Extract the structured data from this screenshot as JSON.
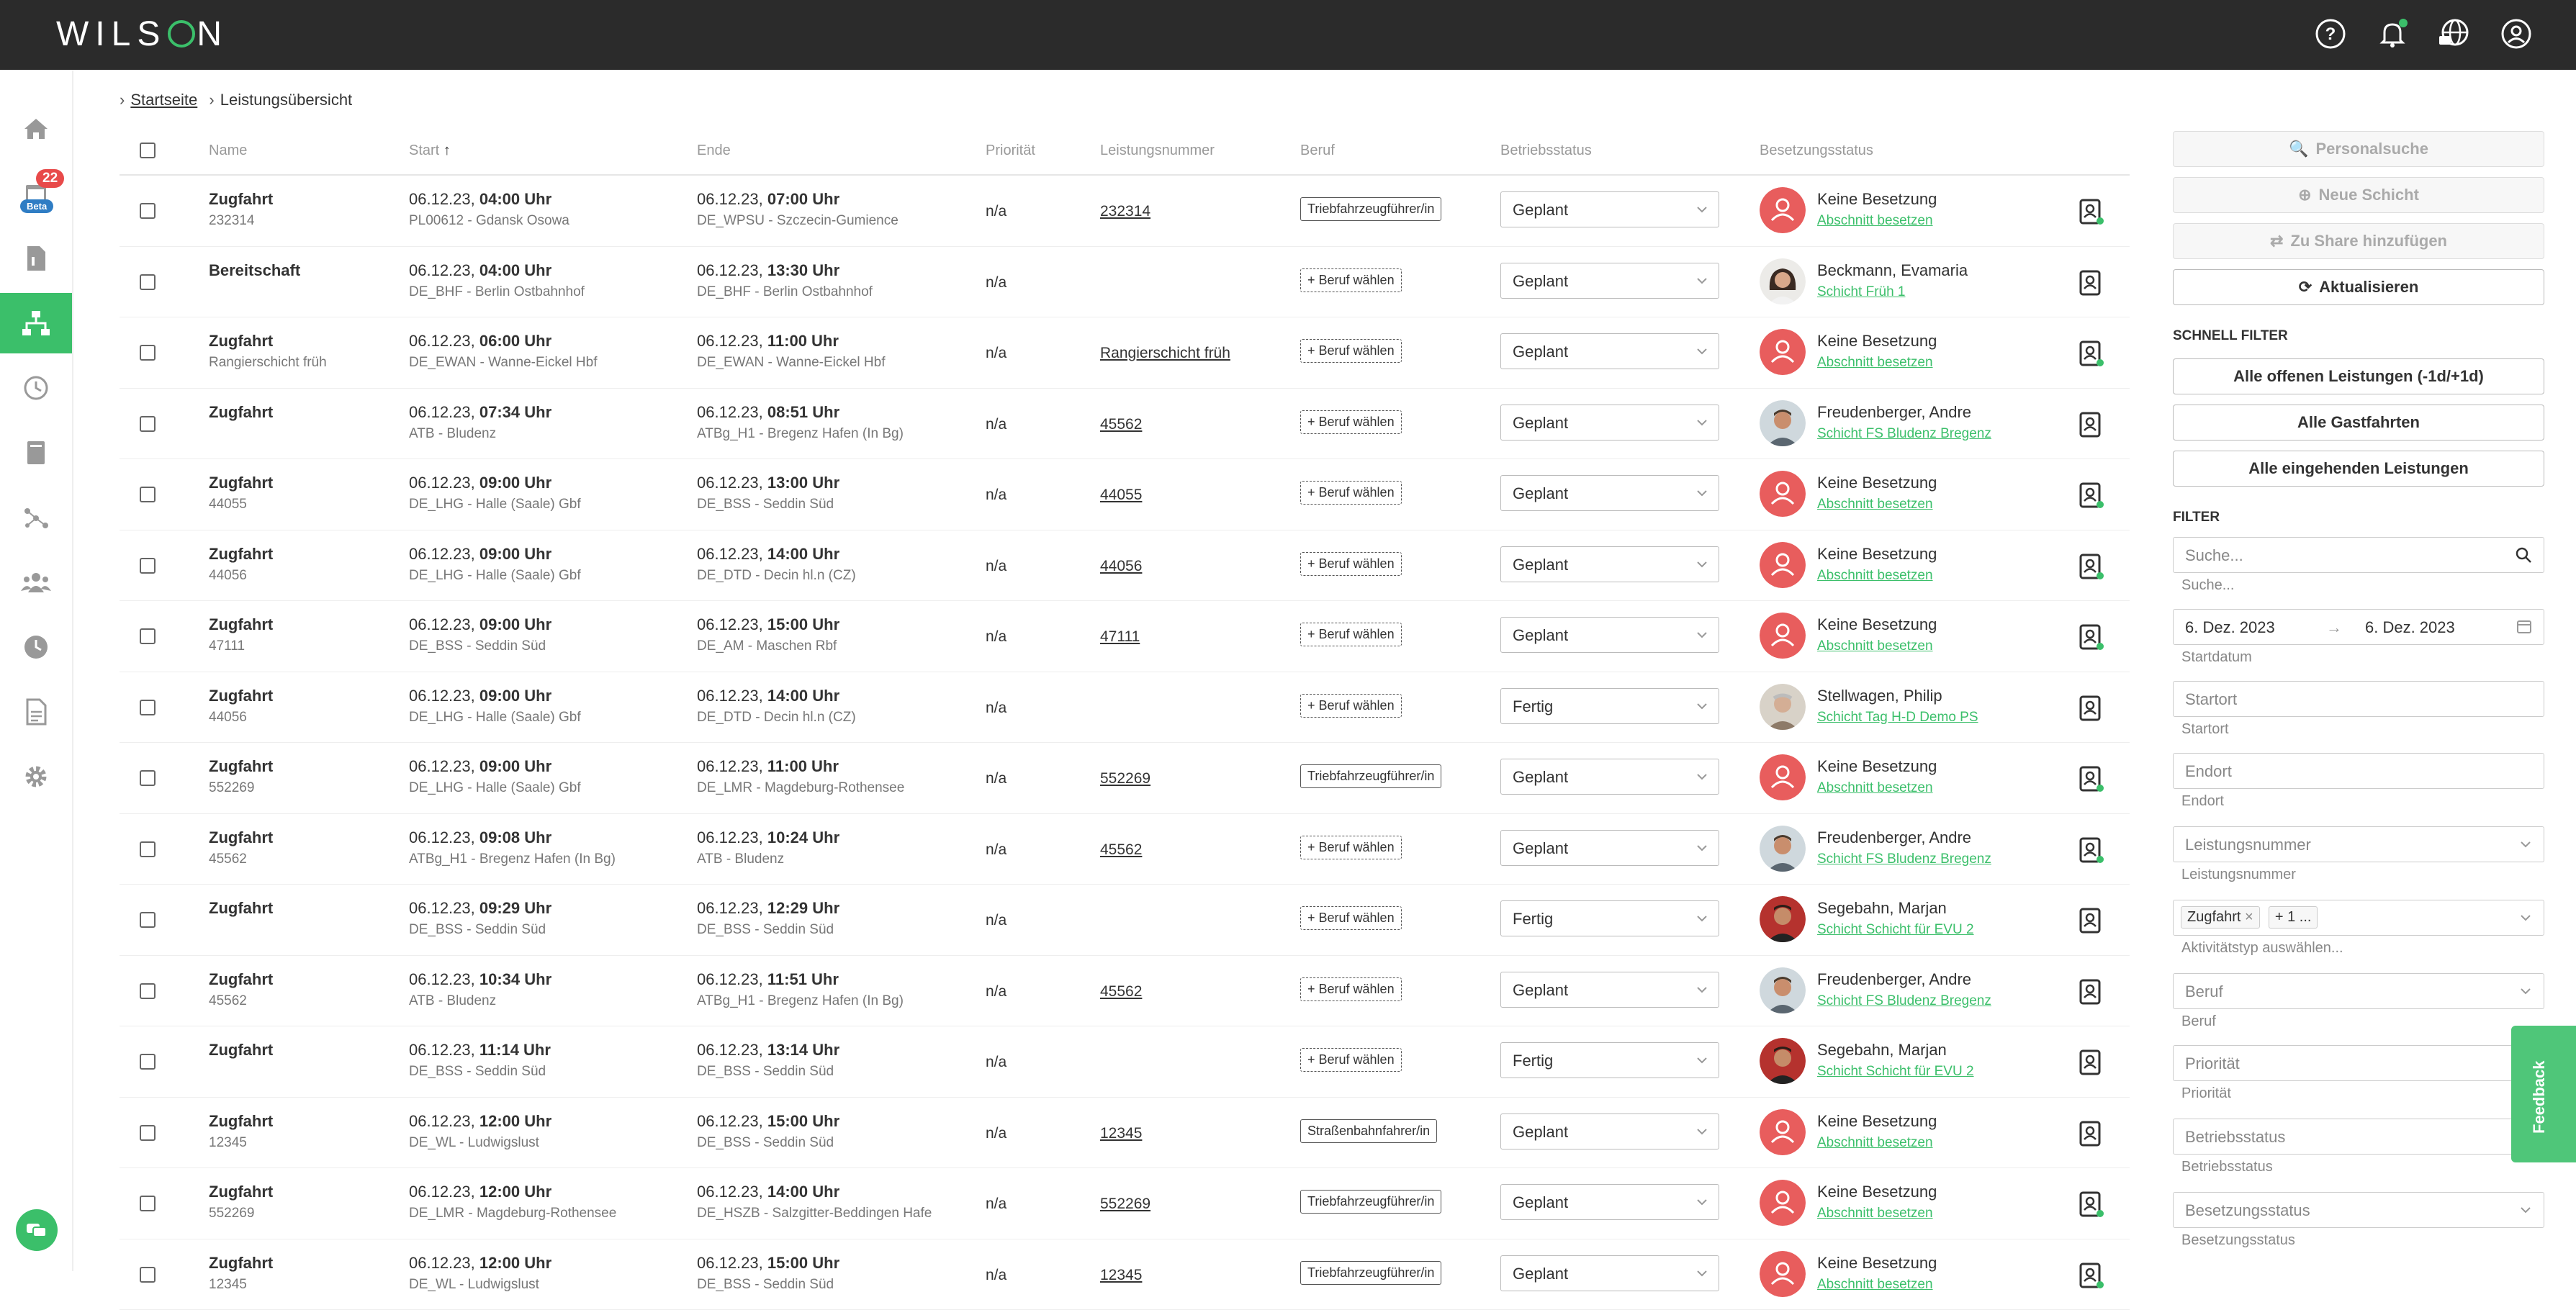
{
  "app": {
    "logo_text_left": "WILS",
    "logo_text_right": "N"
  },
  "sidebar": {
    "badge_count": "22",
    "beta_label": "Beta",
    "accent": "#3bbf6a"
  },
  "breadcrumb": {
    "home": "Startseite",
    "current": "Leistungsübersicht"
  },
  "table": {
    "headers": {
      "name": "Name",
      "start": "Start",
      "end": "Ende",
      "priority": "Priorität",
      "leistungsnummer": "Leistungsnummer",
      "beruf": "Beruf",
      "betriebsstatus": "Betriebsstatus",
      "besetzungsstatus": "Besetzungsstatus"
    },
    "rows": [
      {
        "name": "Zugfahrt",
        "sub": "232314",
        "start_date": "06.12.23,",
        "start_time": "04:00 Uhr",
        "start_loc": "PL00612 - Gdansk Osowa",
        "end_date": "06.12.23,",
        "end_time": "07:00 Uhr",
        "end_loc": "DE_WPSU - Szczecin-Gumience",
        "prio": "n/a",
        "lnum": "232314",
        "beruf": "Triebfahrzeugführer/in",
        "beruf_dashed": false,
        "status": "Geplant",
        "person": "Keine Besetzung",
        "link": "Abschnitt besetzen",
        "avatar": "none",
        "act_dot": true
      },
      {
        "name": "Bereitschaft",
        "sub": "",
        "start_date": "06.12.23,",
        "start_time": "04:00 Uhr",
        "start_loc": "DE_BHF - Berlin Ostbahnhof",
        "end_date": "06.12.23,",
        "end_time": "13:30 Uhr",
        "end_loc": "DE_BHF - Berlin Ostbahnhof",
        "prio": "n/a",
        "lnum": "",
        "beruf": "+ Beruf wählen",
        "beruf_dashed": true,
        "status": "Geplant",
        "person": "Beckmann, Evamaria",
        "link": "Schicht Früh 1",
        "avatar": "woman",
        "act_dot": false
      },
      {
        "name": "Zugfahrt",
        "sub": "Rangierschicht früh",
        "start_date": "06.12.23,",
        "start_time": "06:00 Uhr",
        "start_loc": "DE_EWAN - Wanne-Eickel Hbf",
        "end_date": "06.12.23,",
        "end_time": "11:00 Uhr",
        "end_loc": "DE_EWAN - Wanne-Eickel Hbf",
        "prio": "n/a",
        "lnum": "Rangierschicht früh",
        "beruf": "+ Beruf wählen",
        "beruf_dashed": true,
        "status": "Geplant",
        "person": "Keine Besetzung",
        "link": "Abschnitt besetzen",
        "avatar": "none",
        "act_dot": true
      },
      {
        "name": "Zugfahrt",
        "sub": "",
        "start_date": "06.12.23,",
        "start_time": "07:34 Uhr",
        "start_loc": "ATB - Bludenz",
        "end_date": "06.12.23,",
        "end_time": "08:51 Uhr",
        "end_loc": "ATBg_H1 - Bregenz Hafen (In Bg)",
        "prio": "n/a",
        "lnum": "45562",
        "beruf": "+ Beruf wählen",
        "beruf_dashed": true,
        "status": "Geplant",
        "person": "Freudenberger, Andre",
        "link": "Schicht FS Bludenz Bregenz",
        "avatar": "man1",
        "act_dot": false
      },
      {
        "name": "Zugfahrt",
        "sub": "44055",
        "start_date": "06.12.23,",
        "start_time": "09:00 Uhr",
        "start_loc": "DE_LHG - Halle (Saale) Gbf",
        "end_date": "06.12.23,",
        "end_time": "13:00 Uhr",
        "end_loc": "DE_BSS - Seddin Süd",
        "prio": "n/a",
        "lnum": "44055",
        "beruf": "+ Beruf wählen",
        "beruf_dashed": true,
        "status": "Geplant",
        "person": "Keine Besetzung",
        "link": "Abschnitt besetzen",
        "avatar": "none",
        "act_dot": true
      },
      {
        "name": "Zugfahrt",
        "sub": "44056",
        "start_date": "06.12.23,",
        "start_time": "09:00 Uhr",
        "start_loc": "DE_LHG - Halle (Saale) Gbf",
        "end_date": "06.12.23,",
        "end_time": "14:00 Uhr",
        "end_loc": "DE_DTD - Decin hl.n (CZ)",
        "prio": "n/a",
        "lnum": "44056",
        "beruf": "+ Beruf wählen",
        "beruf_dashed": true,
        "status": "Geplant",
        "person": "Keine Besetzung",
        "link": "Abschnitt besetzen",
        "avatar": "none",
        "act_dot": true
      },
      {
        "name": "Zugfahrt",
        "sub": "47111",
        "start_date": "06.12.23,",
        "start_time": "09:00 Uhr",
        "start_loc": "DE_BSS - Seddin Süd",
        "end_date": "06.12.23,",
        "end_time": "15:00 Uhr",
        "end_loc": "DE_AM - Maschen Rbf",
        "prio": "n/a",
        "lnum": "47111",
        "beruf": "+ Beruf wählen",
        "beruf_dashed": true,
        "status": "Geplant",
        "person": "Keine Besetzung",
        "link": "Abschnitt besetzen",
        "avatar": "none",
        "act_dot": true
      },
      {
        "name": "Zugfahrt",
        "sub": "44056",
        "start_date": "06.12.23,",
        "start_time": "09:00 Uhr",
        "start_loc": "DE_LHG - Halle (Saale) Gbf",
        "end_date": "06.12.23,",
        "end_time": "14:00 Uhr",
        "end_loc": "DE_DTD - Decin hl.n (CZ)",
        "prio": "n/a",
        "lnum": "",
        "beruf": "+ Beruf wählen",
        "beruf_dashed": true,
        "status": "Fertig",
        "person": "Stellwagen, Philip",
        "link": "Schicht Tag H-D Demo PS",
        "avatar": "man2",
        "act_dot": false
      },
      {
        "name": "Zugfahrt",
        "sub": "552269",
        "start_date": "06.12.23,",
        "start_time": "09:00 Uhr",
        "start_loc": "DE_LHG - Halle (Saale) Gbf",
        "end_date": "06.12.23,",
        "end_time": "11:00 Uhr",
        "end_loc": "DE_LMR - Magdeburg-Rothensee",
        "prio": "n/a",
        "lnum": "552269",
        "beruf": "Triebfahrzeugführer/in",
        "beruf_dashed": false,
        "status": "Geplant",
        "person": "Keine Besetzung",
        "link": "Abschnitt besetzen",
        "avatar": "none",
        "act_dot": true
      },
      {
        "name": "Zugfahrt",
        "sub": "45562",
        "start_date": "06.12.23,",
        "start_time": "09:08 Uhr",
        "start_loc": "ATBg_H1 - Bregenz Hafen (In Bg)",
        "end_date": "06.12.23,",
        "end_time": "10:24 Uhr",
        "end_loc": "ATB - Bludenz",
        "prio": "n/a",
        "lnum": "45562",
        "beruf": "+ Beruf wählen",
        "beruf_dashed": true,
        "status": "Geplant",
        "person": "Freudenberger, Andre",
        "link": "Schicht FS Bludenz Bregenz",
        "avatar": "man1",
        "act_dot": true
      },
      {
        "name": "Zugfahrt",
        "sub": "",
        "start_date": "06.12.23,",
        "start_time": "09:29 Uhr",
        "start_loc": "DE_BSS - Seddin Süd",
        "end_date": "06.12.23,",
        "end_time": "12:29 Uhr",
        "end_loc": "DE_BSS - Seddin Süd",
        "prio": "n/a",
        "lnum": "",
        "beruf": "+ Beruf wählen",
        "beruf_dashed": true,
        "status": "Fertig",
        "person": "Segebahn, Marjan",
        "link": "Schicht Schicht für EVU 2",
        "avatar": "man3",
        "act_dot": false
      },
      {
        "name": "Zugfahrt",
        "sub": "45562",
        "start_date": "06.12.23,",
        "start_time": "10:34 Uhr",
        "start_loc": "ATB - Bludenz",
        "end_date": "06.12.23,",
        "end_time": "11:51 Uhr",
        "end_loc": "ATBg_H1 - Bregenz Hafen (In Bg)",
        "prio": "n/a",
        "lnum": "45562",
        "beruf": "+ Beruf wählen",
        "beruf_dashed": true,
        "status": "Geplant",
        "person": "Freudenberger, Andre",
        "link": "Schicht FS Bludenz Bregenz",
        "avatar": "man1",
        "act_dot": false
      },
      {
        "name": "Zugfahrt",
        "sub": "",
        "start_date": "06.12.23,",
        "start_time": "11:14 Uhr",
        "start_loc": "DE_BSS - Seddin Süd",
        "end_date": "06.12.23,",
        "end_time": "13:14 Uhr",
        "end_loc": "DE_BSS - Seddin Süd",
        "prio": "n/a",
        "lnum": "",
        "beruf": "+ Beruf wählen",
        "beruf_dashed": true,
        "status": "Fertig",
        "person": "Segebahn, Marjan",
        "link": "Schicht Schicht für EVU 2",
        "avatar": "man3",
        "act_dot": false
      },
      {
        "name": "Zugfahrt",
        "sub": "12345",
        "start_date": "06.12.23,",
        "start_time": "12:00 Uhr",
        "start_loc": "DE_WL - Ludwigslust",
        "end_date": "06.12.23,",
        "end_time": "15:00 Uhr",
        "end_loc": "DE_BSS - Seddin Süd",
        "prio": "n/a",
        "lnum": "12345",
        "beruf": "Straßenbahnfahrer/in",
        "beruf_dashed": false,
        "status": "Geplant",
        "person": "Keine Besetzung",
        "link": "Abschnitt besetzen",
        "avatar": "none",
        "act_dot": false
      },
      {
        "name": "Zugfahrt",
        "sub": "552269",
        "start_date": "06.12.23,",
        "start_time": "12:00 Uhr",
        "start_loc": "DE_LMR - Magdeburg-Rothensee",
        "end_date": "06.12.23,",
        "end_time": "14:00 Uhr",
        "end_loc": "DE_HSZB - Salzgitter-Beddingen Hafe",
        "prio": "n/a",
        "lnum": "552269",
        "beruf": "Triebfahrzeugführer/in",
        "beruf_dashed": false,
        "status": "Geplant",
        "person": "Keine Besetzung",
        "link": "Abschnitt besetzen",
        "avatar": "none",
        "act_dot": true
      },
      {
        "name": "Zugfahrt",
        "sub": "12345",
        "start_date": "06.12.23,",
        "start_time": "12:00 Uhr",
        "start_loc": "DE_WL - Ludwigslust",
        "end_date": "06.12.23,",
        "end_time": "15:00 Uhr",
        "end_loc": "DE_BSS - Seddin Süd",
        "prio": "n/a",
        "lnum": "12345",
        "beruf": "Triebfahrzeugführer/in",
        "beruf_dashed": false,
        "status": "Geplant",
        "person": "Keine Besetzung",
        "link": "Abschnitt besetzen",
        "avatar": "none",
        "act_dot": true
      }
    ]
  },
  "right_panel": {
    "btn_personalsuche": "Personalsuche",
    "btn_neue_schicht": "Neue Schicht",
    "btn_zu_share": "Zu Share hinzufügen",
    "btn_aktualisieren": "Aktualisieren",
    "schnell_filter_title": "SCHNELL FILTER",
    "qf_offene": "Alle offenen Leistungen (-1d/+1d)",
    "qf_gastfahrten": "Alle Gastfahrten",
    "qf_eingehende": "Alle eingehenden Leistungen",
    "filter_title": "FILTER",
    "search_placeholder": "Suche...",
    "search_sub": "Suche...",
    "date_from": "6. Dez. 2023",
    "date_to": "6. Dez. 2023",
    "startdatum_sub": "Startdatum",
    "startort_placeholder": "Startort",
    "startort_sub": "Startort",
    "endort_placeholder": "Endort",
    "endort_sub": "Endort",
    "leistungsnummer_placeholder": "Leistungsnummer",
    "leistungsnummer_sub": "Leistungsnummer",
    "activity_tag": "Zugfahrt",
    "activity_more": "+ 1 ...",
    "activity_sub": "Aktivitätstyp auswählen...",
    "beruf_placeholder": "Beruf",
    "beruf_sub": "Beruf",
    "prioritaet_placeholder": "Priorität",
    "prioritaet_sub": "Priorität",
    "betriebsstatus_placeholder": "Betriebsstatus",
    "betriebsstatus_sub": "Betriebsstatus",
    "besetzungsstatus_placeholder": "Besetzungsstatus",
    "besetzungsstatus_sub": "Besetzungsstatus"
  },
  "feedback_label": "Feedback"
}
